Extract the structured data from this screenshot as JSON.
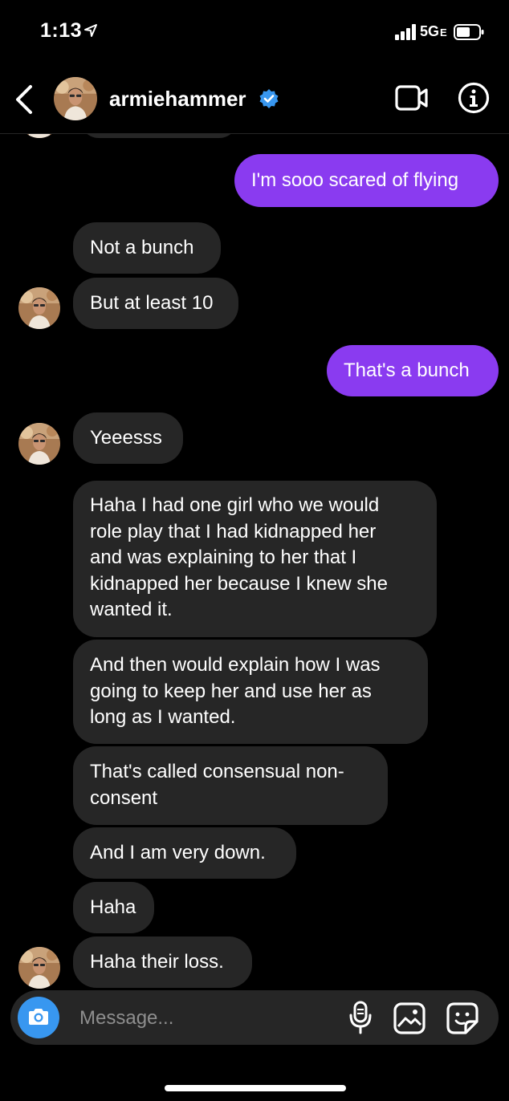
{
  "status_bar": {
    "time": "1:13",
    "network": "5G",
    "network_suffix": "E"
  },
  "header": {
    "username": "armiehammer",
    "verified": true,
    "accent_color": "#3897f0"
  },
  "messages": [
    {
      "sender": "me",
      "text": "I'm sooo scared of flying"
    },
    {
      "sender": "them",
      "text": "Not a bunch"
    },
    {
      "sender": "them",
      "text": "But at least 10"
    },
    {
      "sender": "me",
      "text": "That's a bunch"
    },
    {
      "sender": "them",
      "text": "Yeeesss"
    },
    {
      "sender": "them",
      "lines": [
        "Haha I had one girl who we would",
        "role play that I had kidnapped her",
        "and was explaining to her that I",
        "kidnapped her because I knew she",
        "wanted it."
      ]
    },
    {
      "sender": "them",
      "lines": [
        "And then would explain how I was",
        "going to keep her and use her as",
        "long as I wanted."
      ]
    },
    {
      "sender": "them",
      "lines": [
        "That's called consensual non-",
        "consent"
      ]
    },
    {
      "sender": "them",
      "text": "And I am very down."
    },
    {
      "sender": "them",
      "text": "Haha"
    },
    {
      "sender": "them",
      "text": "Haha their loss."
    }
  ],
  "composer": {
    "placeholder": "Message..."
  },
  "colors": {
    "outgoing_bubble": "#8a3bf0",
    "incoming_bubble": "#262626",
    "background": "#000000"
  }
}
